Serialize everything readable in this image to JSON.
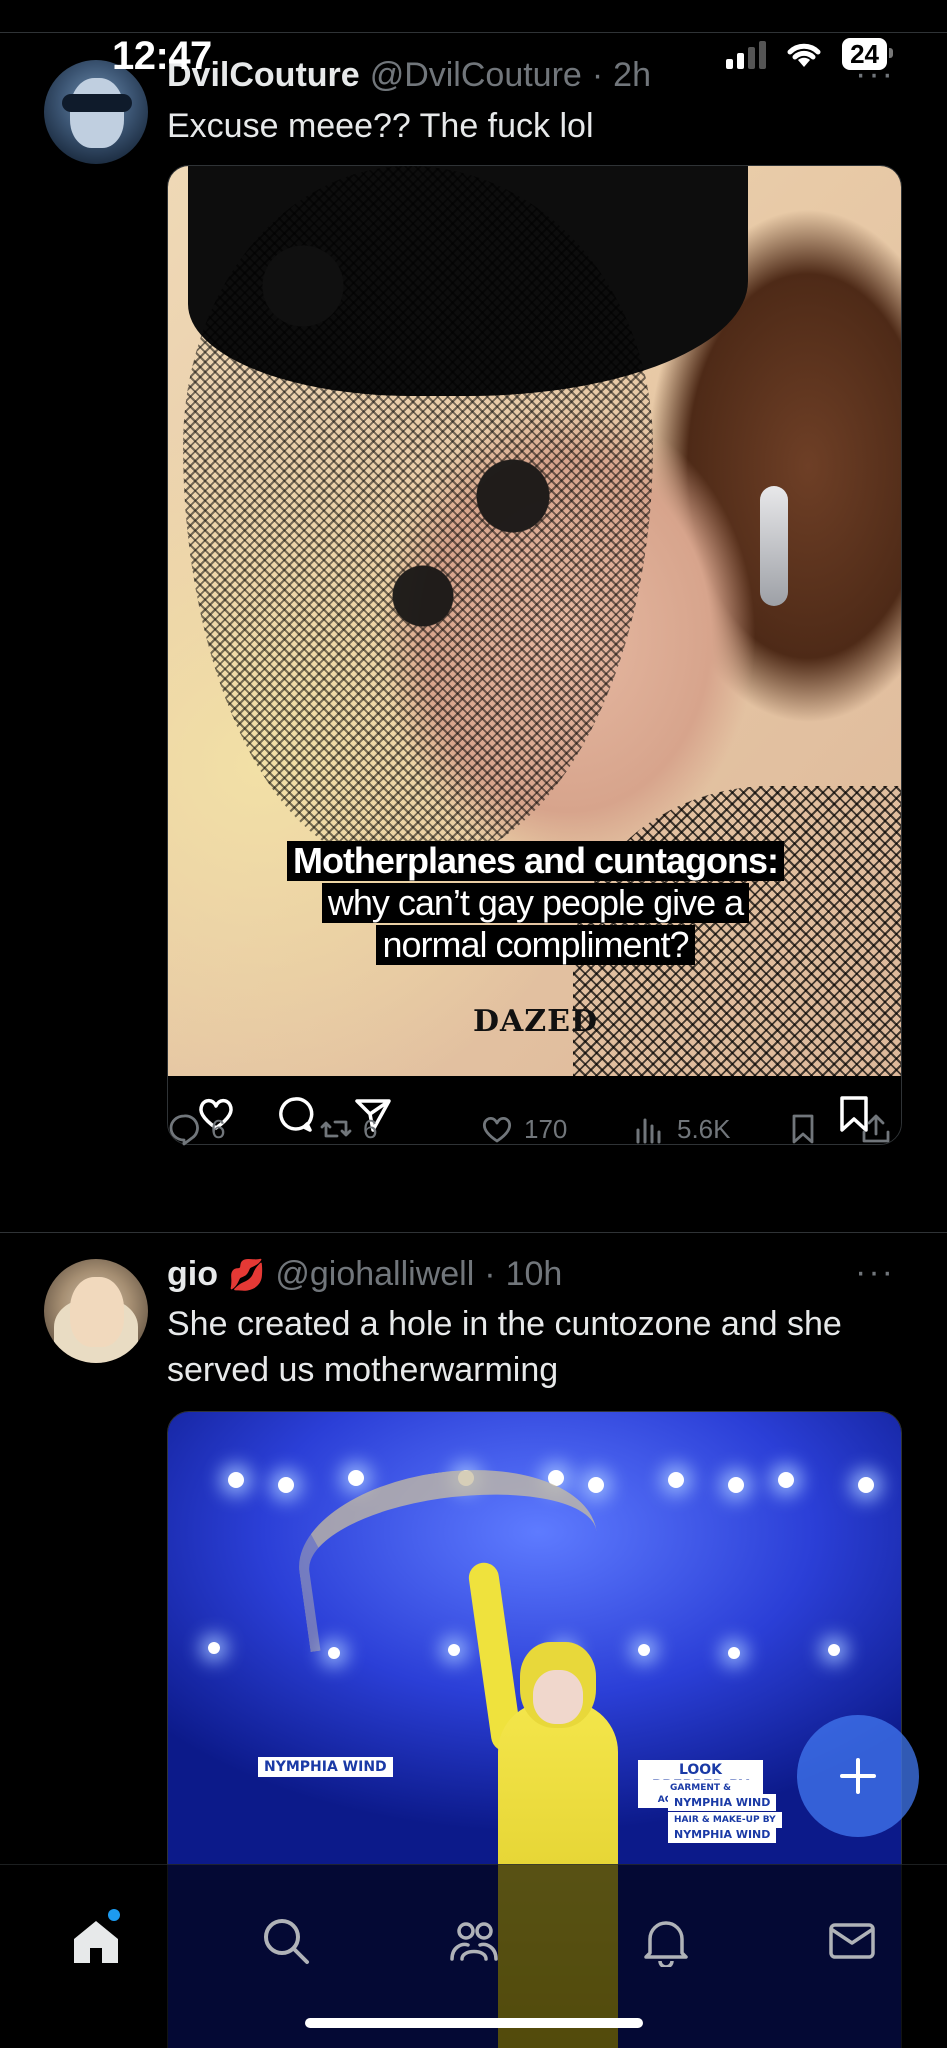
{
  "status_bar": {
    "time": "12:47",
    "battery": "24"
  },
  "tweets": [
    {
      "display_name": "DvilCouture",
      "handle": "@DvilCouture",
      "separator": "·",
      "time": "2h",
      "more": "···",
      "text": "Excuse meee?? The fuck lol",
      "media": {
        "caption_line1": "Motherplanes and cuntagons:",
        "caption_line2": "why can’t gay people give a",
        "caption_line3": "normal compliment?",
        "brand": "DAZED"
      },
      "stats": {
        "replies": "6",
        "reposts": "6",
        "likes": "170",
        "views": "5.6K"
      }
    },
    {
      "display_name": "gio",
      "handle": "@giohalliwell",
      "separator": "·",
      "time": "10h",
      "more": "···",
      "text": "She created a hole in the cuntozone and she served us motherwarming",
      "media": {
        "sign_left": "NYMPHIA WIND",
        "sign_right_title": "LOOK PREPPED BY",
        "sign_right_line1": "GARMENT & ACCESSORIES BY",
        "sign_right_line2": "NYMPHIA WIND",
        "sign_right_line3": "HAIR & MAKE-UP BY",
        "sign_right_line4": "NYMPHIA WIND"
      }
    }
  ],
  "colors": {
    "accent": "#1d9bf0",
    "muted": "#71767b",
    "text": "#e7e9ea",
    "background": "#000000"
  }
}
